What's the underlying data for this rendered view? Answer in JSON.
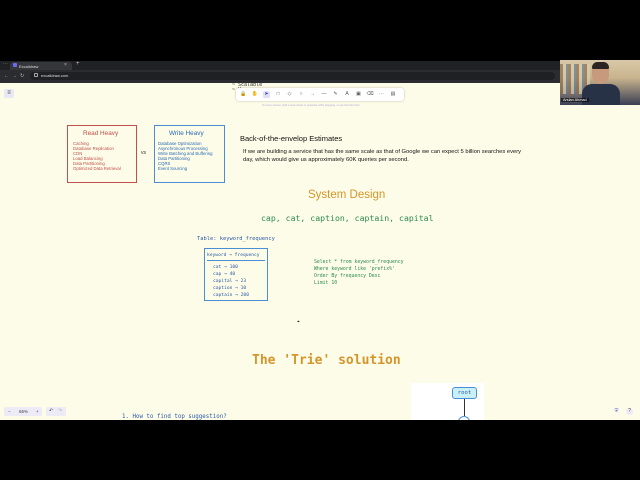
{
  "browser": {
    "tab_title": "Excalidraw",
    "url": "excalidraw.com",
    "new_tab": "+",
    "tab_close": "×",
    "back": "←",
    "forward": "→",
    "reload": "↻"
  },
  "canvas": {
    "menu": "≡",
    "scalable_label": "~ Scalable\n~ H",
    "toolbar_tools": [
      "lock-icon",
      "hand-icon",
      "selection-icon",
      "rectangle-icon",
      "diamond-icon",
      "ellipse-icon",
      "arrow-icon",
      "line-icon",
      "pencil-icon",
      "text-icon",
      "image-icon",
      "eraser-icon",
      "extra-tools-icon",
      "library-icon"
    ],
    "toolbar_glyphs": [
      "🔒",
      "✋",
      "➤",
      "□",
      "◇",
      "○",
      "→",
      "—",
      "✎",
      "A",
      "▣",
      "⌫",
      "⋯",
      "▤"
    ],
    "hint": "To move canvas, hold mouse wheel or spacebar while dragging, or use the hand tool",
    "read_heavy": {
      "title": "Read Heavy",
      "items": [
        "Caching",
        "Database Replication",
        "CDN",
        "Load Balancing",
        "Data Partitioning",
        "Optimized Data Retrieval"
      ],
      "color": "#c0504d"
    },
    "vs": "vs",
    "write_heavy": {
      "title": "Write Heavy",
      "items": [
        "Database Optimization",
        "Asynchronous Processing",
        "Write Batching and Buffering",
        "Data Partitioning",
        "CQRS",
        "Event Sourcing"
      ],
      "color": "#4a8fd6"
    },
    "estimates_heading": "Back-of-the-envelop Estimates",
    "estimates_text": "If we are building a service that has the same scale as that of Google we can expect 5 billion searches every day, which would give us approximately 60K queries per second.",
    "system_design_heading": "System Design",
    "words": "cap, cat, caption, captain, capital",
    "table_label": "Table: keyword_frequency",
    "table_header": "keyword → frequency",
    "table_rows": [
      "cat → 100",
      "cap → 40",
      "capital → 23",
      "caption → 10",
      "captain → 200"
    ],
    "sql": [
      "Select * from keyword_frequency",
      "Where keyword like 'prefix%'",
      "Order By frequency Desc",
      "Limit 10"
    ],
    "trie_heading": "The 'Trie' solution",
    "question": "1. How to find top suggestion?",
    "root_node": "root",
    "zoom": {
      "minus": "−",
      "level": "65%",
      "plus": "+"
    },
    "undo": "↶",
    "redo": "↷",
    "accent": "#d4952a"
  },
  "webcam": {
    "name": "Arslan Ahmad"
  }
}
